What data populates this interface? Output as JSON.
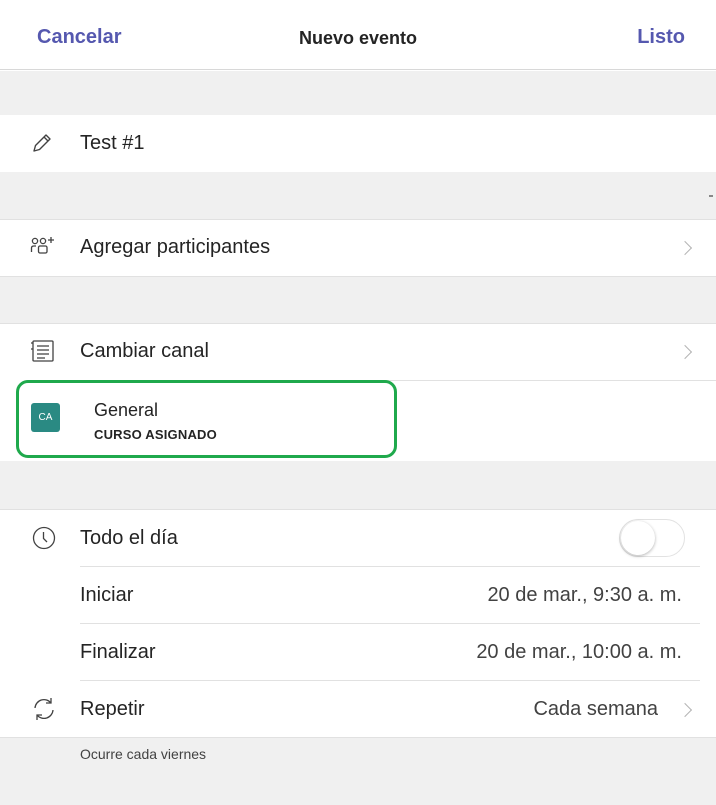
{
  "nav": {
    "cancel": "Cancelar",
    "title": "Nuevo evento",
    "done": "Listo"
  },
  "title_field": {
    "value": "Test #1",
    "icon": "pencil-icon"
  },
  "participants": {
    "label": "Agregar participantes",
    "icon": "add-people-icon"
  },
  "channel": {
    "label": "Cambiar canal",
    "icon": "channel-list-icon",
    "selected": {
      "badge": "CA",
      "name": "General",
      "team": "CURSO ASIGNADO",
      "badge_color": "#2a8a83"
    },
    "highlight_color": "#1fa94c"
  },
  "all_day": {
    "label": "Todo el día",
    "icon": "clock-icon",
    "enabled": false
  },
  "start": {
    "label": "Iniciar",
    "value": "20 de mar., 9:30 a. m."
  },
  "end": {
    "label": "Finalizar",
    "value": "20 de mar., 10:00 a. m."
  },
  "repeat": {
    "label": "Repetir",
    "value": "Cada semana",
    "icon": "repeat-icon",
    "note": "Ocurre cada viernes"
  },
  "accent_color": "#5558af"
}
